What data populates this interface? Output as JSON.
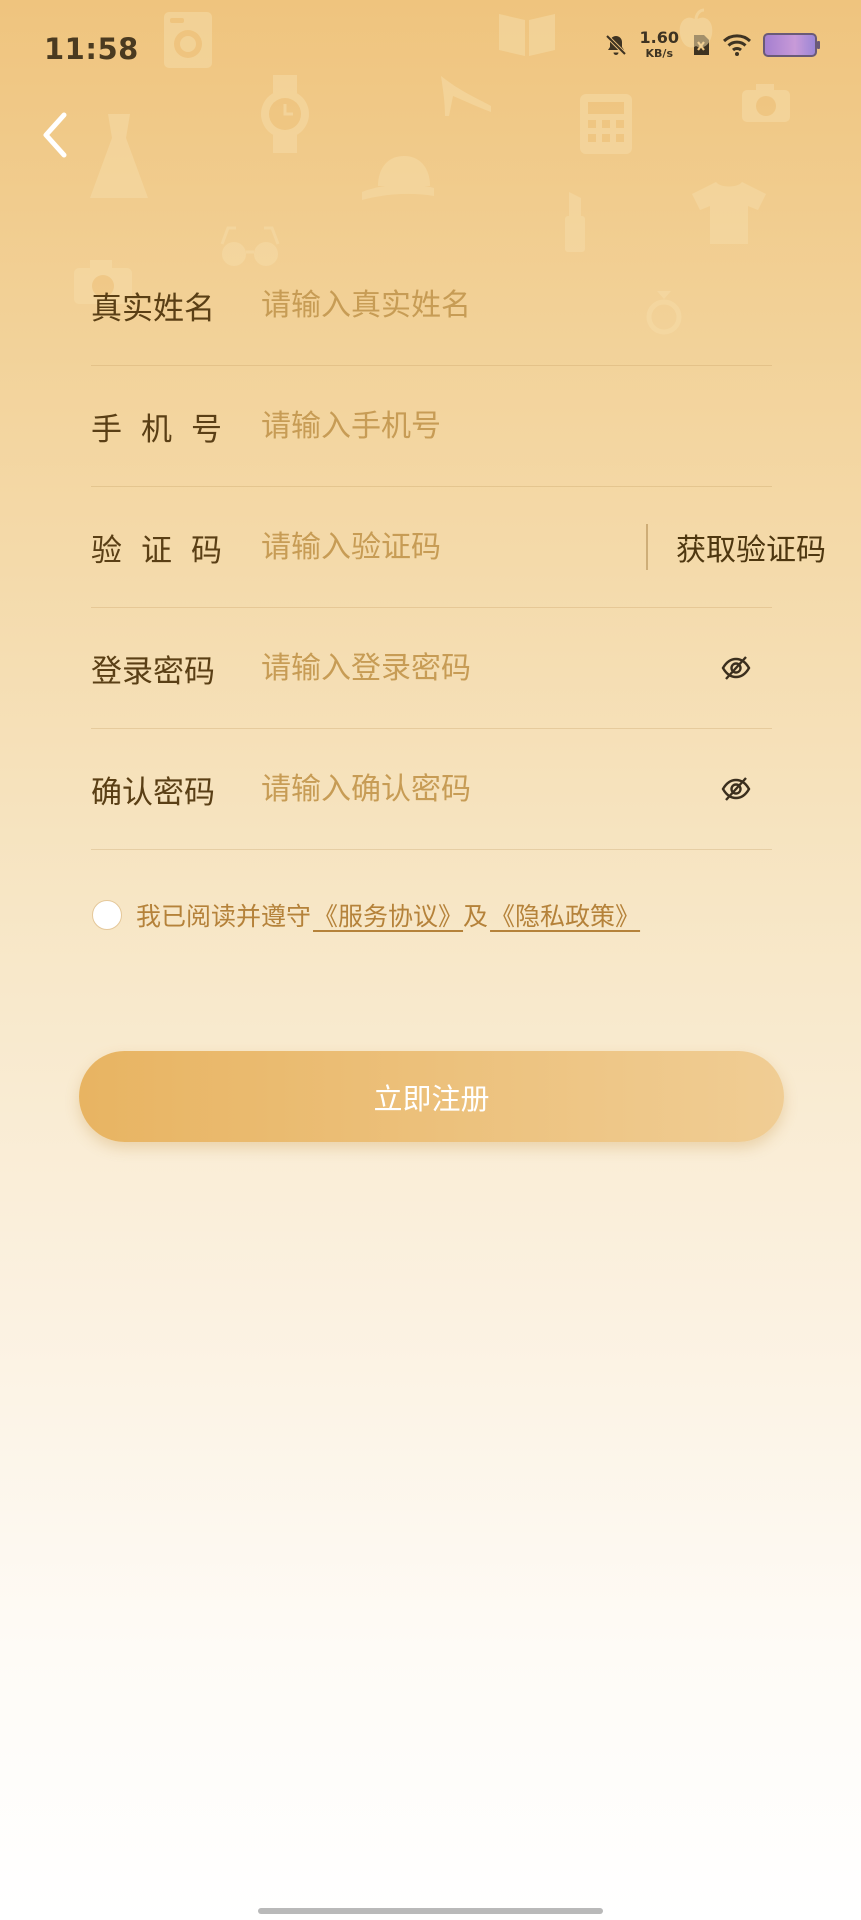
{
  "status_bar": {
    "time": "11:58",
    "net_speed_value": "1.60",
    "net_speed_unit": "KB/s",
    "icons": [
      "bell-muted-icon",
      "sim-x-icon",
      "wifi-icon",
      "battery-icon"
    ]
  },
  "nav": {
    "back_icon": "chevron-left-icon"
  },
  "background": {
    "decor_icons": [
      "washing-machine-icon",
      "book-icon",
      "apple-icon",
      "dress-icon",
      "watch-icon",
      "high-heel-icon",
      "calculator-icon",
      "camera-icon",
      "cap-icon",
      "glasses-icon",
      "lipstick-icon",
      "tshirt-icon",
      "ring-icon"
    ]
  },
  "form": {
    "real_name": {
      "label": "真实姓名",
      "placeholder": "请输入真实姓名",
      "value": ""
    },
    "phone": {
      "label": "手机号",
      "placeholder": "请输入手机号",
      "value": ""
    },
    "code": {
      "label": "验证码",
      "placeholder": "请输入验证码",
      "value": "",
      "get_code_label": "获取验证码"
    },
    "password": {
      "label": "登录密码",
      "placeholder": "请输入登录密码",
      "value": "",
      "toggle_icon": "eye-slash-icon"
    },
    "confirm": {
      "label": "确认密码",
      "placeholder": "请输入确认密码",
      "value": "",
      "toggle_icon": "eye-slash-icon"
    }
  },
  "agreement": {
    "text": "我已阅读并遵守",
    "service_link": "《服务协议》",
    "and": "及",
    "privacy_link": "《隐私政策》"
  },
  "submit_label": "立即注册",
  "colors": {
    "accent": "#e8b462",
    "label_text": "#5a3f15",
    "placeholder_text": "#c79c55",
    "link_text": "#b5823a",
    "background_top": "#efc47e"
  }
}
